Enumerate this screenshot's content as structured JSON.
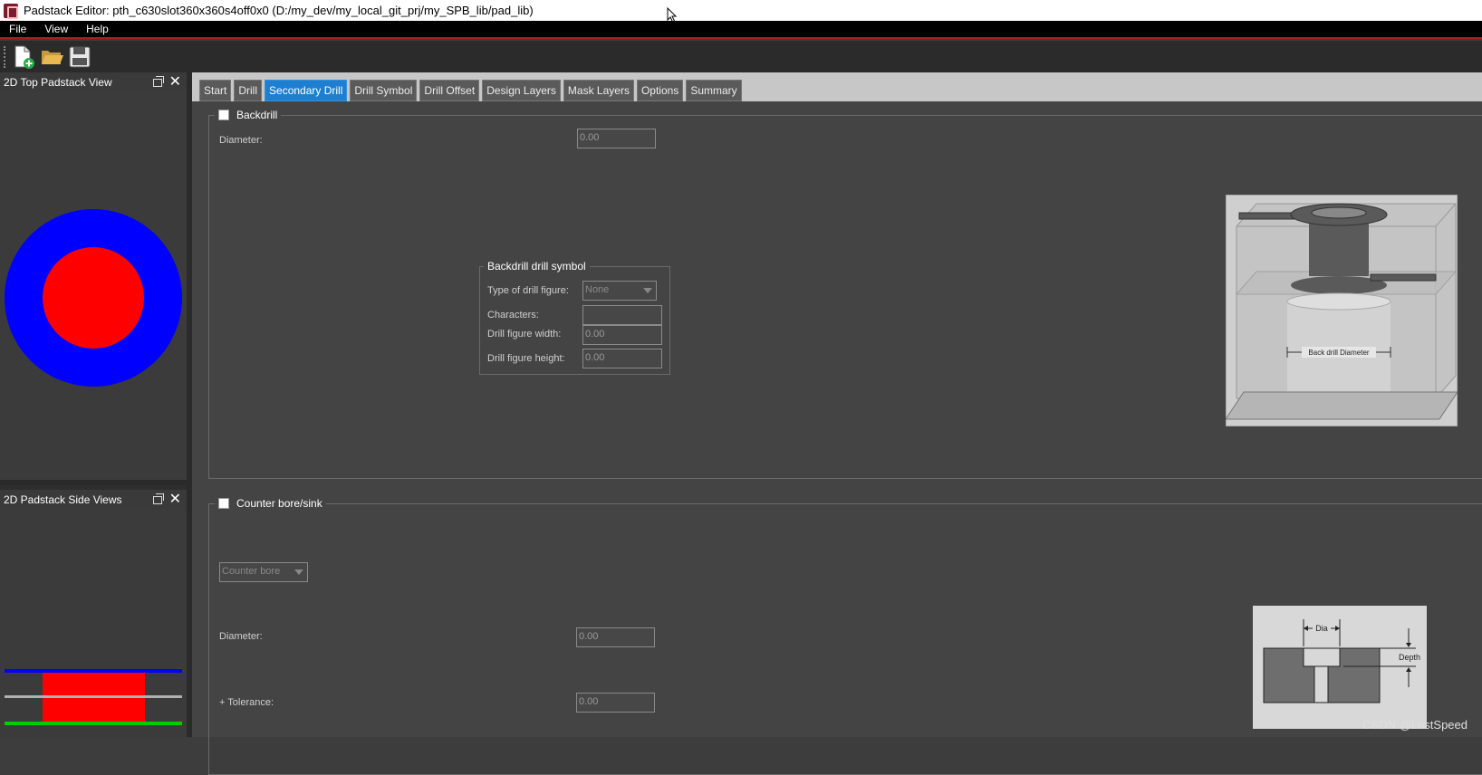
{
  "window": {
    "title": "Padstack Editor: pth_c630slot360x360s4off0x0  (D:/my_dev/my_local_git_prj/my_SPB_lib/pad_lib)"
  },
  "menu": [
    "File",
    "View",
    "Help"
  ],
  "toolbar": {
    "buttons": [
      "new-file-icon",
      "open-folder-icon",
      "save-icon"
    ]
  },
  "panels": {
    "top_view": {
      "title": "2D Top Padstack View"
    },
    "side_views": {
      "title": "2D Padstack Side Views"
    }
  },
  "tabs": [
    {
      "label": "Start",
      "active": false
    },
    {
      "label": "Drill",
      "active": false
    },
    {
      "label": "Secondary Drill",
      "active": true
    },
    {
      "label": "Drill Symbol",
      "active": false
    },
    {
      "label": "Drill Offset",
      "active": false
    },
    {
      "label": "Design Layers",
      "active": false
    },
    {
      "label": "Mask Layers",
      "active": false
    },
    {
      "label": "Options",
      "active": false
    },
    {
      "label": "Summary",
      "active": false
    }
  ],
  "backdrill": {
    "title": "Backdrill",
    "checked": false,
    "diameter_label": "Diameter:",
    "diameter_value": "0.00",
    "symbol": {
      "title": "Backdrill drill symbol",
      "type_label": "Type of drill figure:",
      "type_value": "None",
      "characters_label": "Characters:",
      "characters_value": "",
      "width_label": "Drill figure width:",
      "width_value": "0.00",
      "height_label": "Drill figure height:",
      "height_value": "0.00"
    },
    "diagram_label": "Back drill Diameter"
  },
  "counterbore": {
    "title": "Counter bore/sink",
    "checked": false,
    "type_value": "Counter bore",
    "diameter_label": "Diameter:",
    "diameter_value": "0.00",
    "tolerance_label": "+ Tolerance:",
    "tolerance_value": "0.00",
    "diagram": {
      "dia_label": "Dia",
      "depth_label": "Depth"
    }
  },
  "colors": {
    "pad_outer": "#0000ff",
    "pad_inner": "#ff0000",
    "layer_top": "#0000ff",
    "layer_mid": "#b0b0b0",
    "layer_bottom": "#00cc00",
    "active_tab": "#1e7fd0"
  },
  "watermark": "CSDN @LostSpeed"
}
